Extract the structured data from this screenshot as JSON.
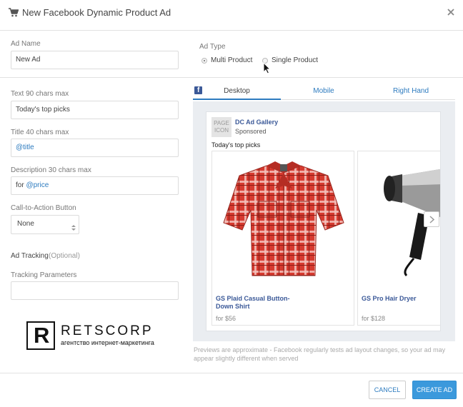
{
  "header": {
    "title": "New Facebook Dynamic Product Ad",
    "icon": "shopping-cart-icon",
    "close_icon": "close-icon"
  },
  "ad_name": {
    "label": "Ad Name",
    "value": "New Ad"
  },
  "ad_type": {
    "label": "Ad Type",
    "options": [
      {
        "label": "Multi Product",
        "selected": true
      },
      {
        "label": "Single Product",
        "selected": false
      }
    ]
  },
  "fields": {
    "text": {
      "label": "Text 90 chars max",
      "value": "Today's top picks"
    },
    "title": {
      "label": "Title 40 chars max",
      "value": "@title"
    },
    "description": {
      "label": "Description 30 chars max",
      "prefix": "for ",
      "token": "@price"
    },
    "cta": {
      "label": "Call-to-Action Button",
      "value": "None"
    },
    "tracking": {
      "heading": "Ad Tracking",
      "optional": "(Optional)",
      "label": "Tracking Parameters",
      "value": ""
    }
  },
  "preview": {
    "tabs": [
      {
        "label": "Desktop",
        "active": true
      },
      {
        "label": "Mobile",
        "active": false
      },
      {
        "label": "Right Hand",
        "active": false
      }
    ],
    "page_icon": [
      "PAGE",
      "ICON"
    ],
    "page_name": "DC Ad Gallery",
    "sponsored": "Sponsored",
    "text": "Today's top picks",
    "products": [
      {
        "title": "GS Plaid Casual Button-Down Shirt",
        "price": "for $56"
      },
      {
        "title": "GS Pro Hair Dryer",
        "price": "for $128"
      }
    ],
    "note": "Previews are approximate - Facebook regularly tests ad layout changes, so your ad may appear slightly different when served"
  },
  "watermark": {
    "brand": "RETSCORP",
    "tagline": "агентство интернет-маркетинга",
    "mark": "R"
  },
  "footer": {
    "cancel": "CANCEL",
    "create": "CREATE AD"
  },
  "colors": {
    "accent": "#2d7bbf",
    "primary_button": "#3b99dc",
    "shirt_red": "#d63a2f"
  }
}
